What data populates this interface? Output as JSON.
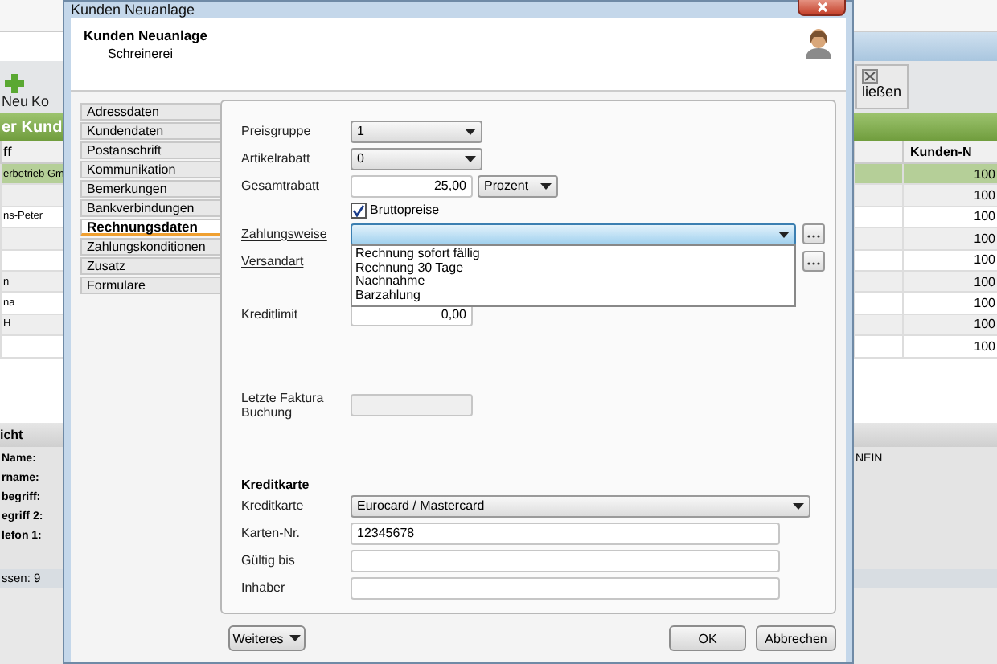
{
  "background_app": {
    "toolbar": {
      "left_button": "Neu",
      "left_button_2": "Ko",
      "right_button": "ließen"
    },
    "list_title": "er Kund",
    "table": {
      "columns": [
        "ff",
        "Kunden-N"
      ],
      "rows": [
        {
          "cells": [
            "erbetrieb Gm",
            "100"
          ],
          "selected": true
        },
        {
          "cells": [
            "",
            "100"
          ],
          "selected": false
        },
        {
          "cells": [
            "ns-Peter",
            "100"
          ],
          "selected": false
        },
        {
          "cells": [
            "",
            "100"
          ],
          "selected": false
        },
        {
          "cells": [
            "",
            "100"
          ],
          "selected": false
        },
        {
          "cells": [
            "n",
            "100"
          ],
          "selected": false
        },
        {
          "cells": [
            "na",
            "100"
          ],
          "selected": false
        },
        {
          "cells": [
            "H",
            "100"
          ],
          "selected": false
        },
        {
          "cells": [
            "",
            "100"
          ],
          "selected": false
        }
      ]
    },
    "detail": {
      "title": "icht",
      "fields": [
        {
          "label": "Name:"
        },
        {
          "label": "rname:"
        },
        {
          "label": "begriff:"
        },
        {
          "label": "egriff 2:"
        },
        {
          "label": "lefon 1:"
        }
      ],
      "extra": "NEIN",
      "footer": "ssen: 9"
    }
  },
  "dialog": {
    "title": "Kunden Neuanlage",
    "header": {
      "title": "Kunden Neuanlage",
      "subtitle": "Schreinerei"
    },
    "tabs": [
      {
        "label": "Adressdaten",
        "selected": false
      },
      {
        "label": "Kundendaten",
        "selected": false
      },
      {
        "label": "Postanschrift",
        "selected": false
      },
      {
        "label": "Kommunikation",
        "selected": false
      },
      {
        "label": "Bemerkungen",
        "selected": false
      },
      {
        "label": "Bankverbindungen",
        "selected": false
      },
      {
        "label": "Rechnungsdaten",
        "selected": true
      },
      {
        "label": "Zahlungskonditionen",
        "selected": false
      },
      {
        "label": "Zusatz",
        "selected": false
      },
      {
        "label": "Formulare",
        "selected": false
      }
    ],
    "form": {
      "preisgruppe": {
        "label": "Preisgruppe",
        "value": "1"
      },
      "artikelrabatt": {
        "label": "Artikelrabatt",
        "value": "0"
      },
      "gesamtrabatt": {
        "label": "Gesamtrabatt",
        "value": "25,00",
        "unit": "Prozent"
      },
      "bruttopreise": {
        "label": "Bruttopreise",
        "checked": true
      },
      "zahlungsweise": {
        "label": "Zahlungsweise",
        "expanded": true,
        "options": [
          "Rechnung sofort fällig",
          "Rechnung 30 Tage",
          "Nachnahme",
          "Barzahlung"
        ]
      },
      "versandart": {
        "label": "Versandart"
      },
      "kreditlimit": {
        "label": "Kreditlimit",
        "value": "0,00"
      },
      "letzte_faktura": {
        "label": "Letzte Faktura Buchung"
      },
      "kreditkarte_section": "Kreditkarte",
      "kreditkarte": {
        "label": "Kreditkarte",
        "value": "Eurocard / Mastercard"
      },
      "karten_nr": {
        "label": "Karten-Nr.",
        "value": "12345678"
      },
      "gueltig_bis": {
        "label": "Gültig bis"
      },
      "inhaber": {
        "label": "Inhaber"
      }
    },
    "buttons": {
      "more": "Weiteres",
      "ok": "OK",
      "cancel": "Abbrechen"
    }
  }
}
